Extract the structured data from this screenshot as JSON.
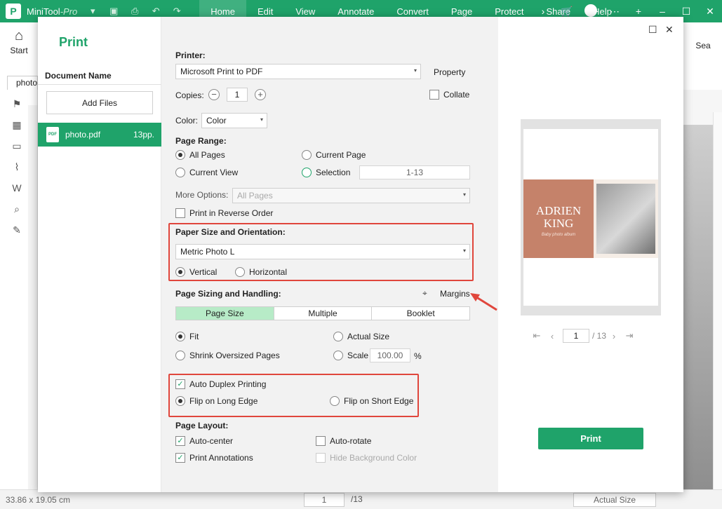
{
  "app": {
    "name": "MiniTool",
    "edition": "-Pro"
  },
  "menu": [
    "Home",
    "Edit",
    "View",
    "Annotate",
    "Convert",
    "Page",
    "Protect",
    "Share",
    "Help"
  ],
  "ribbon": {
    "start_label": "Start",
    "search_label": "Sea"
  },
  "doc_tab": "photo",
  "status": {
    "dimensions": "33.86 x 19.05 cm",
    "page": "1",
    "total": "/13",
    "zoom": "Actual Size"
  },
  "dialog": {
    "title": "Print",
    "document_name_label": "Document Name",
    "add_files": "Add Files",
    "file": {
      "name": "photo.pdf",
      "pages": "13pp."
    },
    "printer_label": "Printer:",
    "printer_value": "Microsoft Print to PDF",
    "property": "Property",
    "copies_label": "Copies:",
    "copies_value": "1",
    "collate": "Collate",
    "color_label": "Color:",
    "color_value": "Color",
    "page_range_label": "Page Range:",
    "all_pages": "All Pages",
    "current_page": "Current Page",
    "current_view": "Current View",
    "selection": "Selection",
    "selection_value": "1-13",
    "more_options_label": "More Options:",
    "more_options_value": "All Pages",
    "reverse_order": "Print in Reverse Order",
    "paper_size_label": "Paper Size and Orientation:",
    "paper_size_value": "Metric Photo L",
    "vertical": "Vertical",
    "horizontal": "Horizontal",
    "sizing_label": "Page Sizing and Handling:",
    "margins": "Margins",
    "tabs": [
      "Page Size",
      "Multiple",
      "Booklet"
    ],
    "fit": "Fit",
    "actual_size": "Actual Size",
    "shrink": "Shrink Oversized Pages",
    "scale": "Scale",
    "scale_value": "100.00",
    "scale_unit": "%",
    "auto_duplex": "Auto Duplex Printing",
    "flip_long": "Flip on Long Edge",
    "flip_short": "Flip on Short Edge",
    "layout_label": "Page Layout:",
    "auto_center": "Auto-center",
    "auto_rotate": "Auto-rotate",
    "print_annotations": "Print Annotations",
    "hide_bg": "Hide Background Color",
    "preview": {
      "title_line1": "ADRIEN",
      "title_line2": "KING",
      "subtitle": "Baby photo album",
      "page": "1",
      "total": "/ 13"
    },
    "print_button": "Print"
  }
}
